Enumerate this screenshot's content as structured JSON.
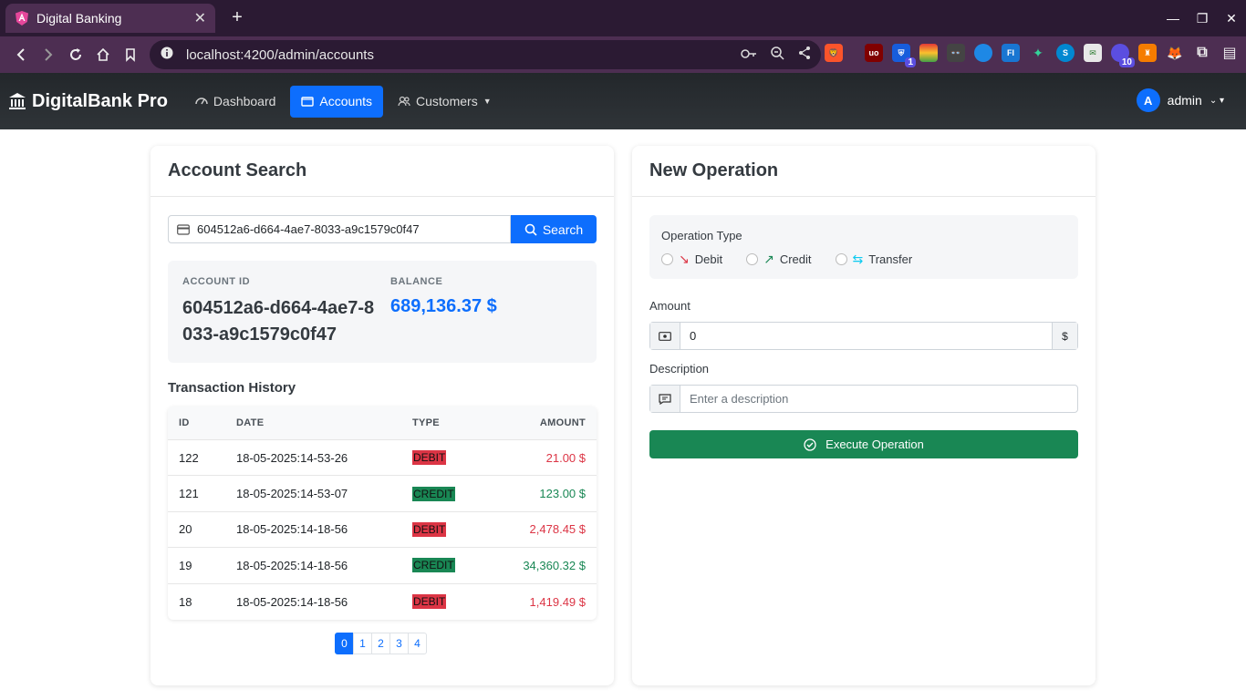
{
  "browser": {
    "tab_title": "Digital Banking",
    "url": "localhost:4200/admin/accounts",
    "ext_badge_1": "1",
    "ext_badge_2": "10"
  },
  "nav": {
    "brand": "DigitalBank Pro",
    "dashboard": "Dashboard",
    "accounts": "Accounts",
    "customers": "Customers",
    "user_initial": "A",
    "user_name": "admin"
  },
  "search": {
    "title": "Account Search",
    "input_value": "604512a6-d664-4ae7-8033-a9c1579c0f47",
    "button": "Search"
  },
  "account": {
    "id_label": "ACCOUNT ID",
    "id_value": "604512a6-d664-4ae7-8033-a9c1579c0f47",
    "balance_label": "BALANCE",
    "balance_value": "689,136.37 $"
  },
  "history": {
    "title": "Transaction History",
    "columns": [
      "ID",
      "DATE",
      "TYPE",
      "AMOUNT"
    ],
    "rows": [
      {
        "id": "122",
        "date": "18-05-2025:14-53-26",
        "type": "DEBIT",
        "amount": "21.00 $"
      },
      {
        "id": "121",
        "date": "18-05-2025:14-53-07",
        "type": "CREDIT",
        "amount": "123.00 $"
      },
      {
        "id": "20",
        "date": "18-05-2025:14-18-56",
        "type": "DEBIT",
        "amount": "2,478.45 $"
      },
      {
        "id": "19",
        "date": "18-05-2025:14-18-56",
        "type": "CREDIT",
        "amount": "34,360.32 $"
      },
      {
        "id": "18",
        "date": "18-05-2025:14-18-56",
        "type": "DEBIT",
        "amount": "1,419.49 $"
      }
    ],
    "pages": [
      "0",
      "1",
      "2",
      "3",
      "4"
    ],
    "current_page": "0"
  },
  "operation": {
    "title": "New Operation",
    "type_label": "Operation Type",
    "debit": "Debit",
    "credit": "Credit",
    "transfer": "Transfer",
    "amount_label": "Amount",
    "amount_value": "0",
    "currency": "$",
    "description_label": "Description",
    "description_placeholder": "Enter a description",
    "execute": "Execute Operation"
  },
  "colors": {
    "primary": "#0d6efd",
    "success": "#198754",
    "danger": "#dc3545",
    "navbar": "#2b3035"
  }
}
